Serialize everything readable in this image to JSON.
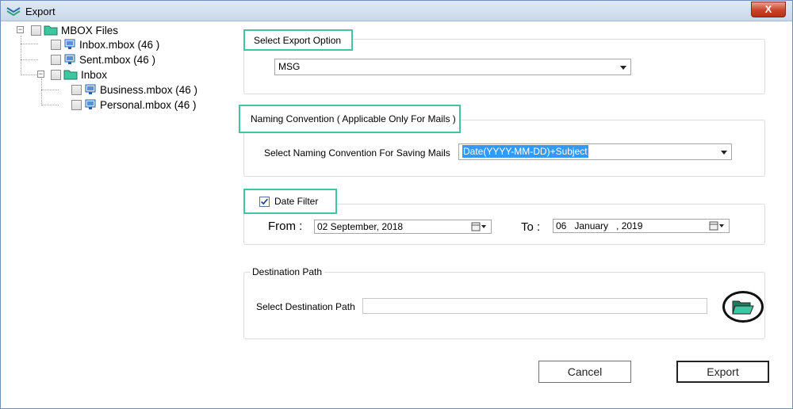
{
  "window": {
    "title": "Export",
    "close_label": "X"
  },
  "tree": {
    "root": {
      "label": "MBOX Files",
      "expander": "−"
    },
    "items": [
      {
        "label": "Inbox.mbox (46 )"
      },
      {
        "label": "Sent.mbox (46 )"
      },
      {
        "label": "Inbox",
        "expander": "−"
      },
      {
        "label": "Business.mbox (46 )"
      },
      {
        "label": "Personal.mbox (46 )"
      }
    ]
  },
  "export_option": {
    "title": "Select Export Option",
    "selected": "MSG"
  },
  "naming": {
    "title": "Naming Convention ( Applicable Only For Mails )",
    "label": "Select Naming Convention For Saving Mails",
    "selected": "Date(YYYY-MM-DD)+Subject"
  },
  "date_filter": {
    "title": "Date Filter",
    "checked": true,
    "from_label": "From :",
    "from_value": "02 September, 2018",
    "to_label": "To :",
    "to_value": "06   January   , 2019"
  },
  "destination": {
    "title": "Destination Path",
    "label": "Select Destination Path",
    "value": ""
  },
  "buttons": {
    "cancel": "Cancel",
    "export": "Export"
  },
  "colors": {
    "highlight_border": "#3ec6a0",
    "selection": "#3399ff",
    "folder": "#3ec6a0"
  }
}
